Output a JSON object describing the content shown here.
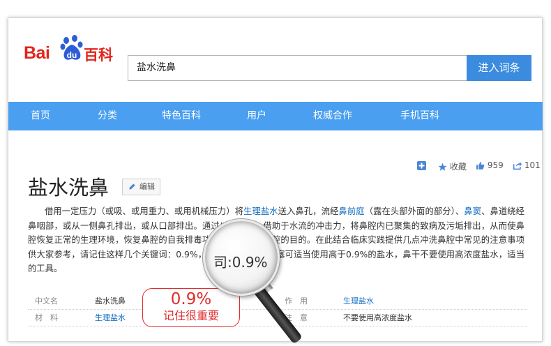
{
  "logo": {
    "bai": "Bai",
    "du": "du",
    "baike": "百科"
  },
  "search": {
    "value": "盐水洗鼻",
    "button": "进入词条"
  },
  "nav": [
    "首页",
    "分类",
    "特色百科",
    "用户",
    "权威合作",
    "手机百科"
  ],
  "toolbar": {
    "collect": "收藏",
    "likes": "959",
    "shares": "101"
  },
  "article": {
    "title": "盐水洗鼻",
    "edit_label": "编辑",
    "p1": "借用一定压力（或吸、或用重力、或用机械压力）将",
    "l1": "生理盐水",
    "p2": "送入鼻孔，流经",
    "l2": "鼻前庭",
    "p3": "（露在头部外面的部分）、",
    "l3": "鼻窦",
    "p4": "、鼻道绕经鼻咽部，或从一侧鼻孔排出，或从口部排出。通过以上路径，借助于水流的冲击力，将鼻腔内已聚集的致病及污垢排出，从而使鼻腔恢复正常的生理环境，恢复鼻腔的自我排毒功能，达到保护鼻腔的目的。在此结合临床实践提供几点冲洗鼻腔中常见的注意事项供大家参考，请记住这样几个关键词：0.9%，生理盐水的盐，鼻塞可适当使用高于0.9%的盐水，鼻干不要使用高浓度盐水，适当的工具。"
  },
  "info": {
    "r1": {
      "k1": "中文名",
      "v1": "盐水洗鼻",
      "k2": "作　用",
      "v2": "生理盐水"
    },
    "r2": {
      "k1": "材　料",
      "v1": "生理盐水",
      "k2": "注　意",
      "v2": "不要使用高浓度盐水"
    }
  },
  "callout": {
    "big": "0.9%",
    "small": "记住很重要"
  },
  "magnifier": {
    "text": "司:0.9%"
  },
  "colors": {
    "brand_red": "#e1251b",
    "brand_blue": "#2d5cd6",
    "nav_blue": "#4a9ff0",
    "button_blue": "#3b8bdf",
    "link": "#136ec2",
    "alert_red": "#e02b2b"
  }
}
